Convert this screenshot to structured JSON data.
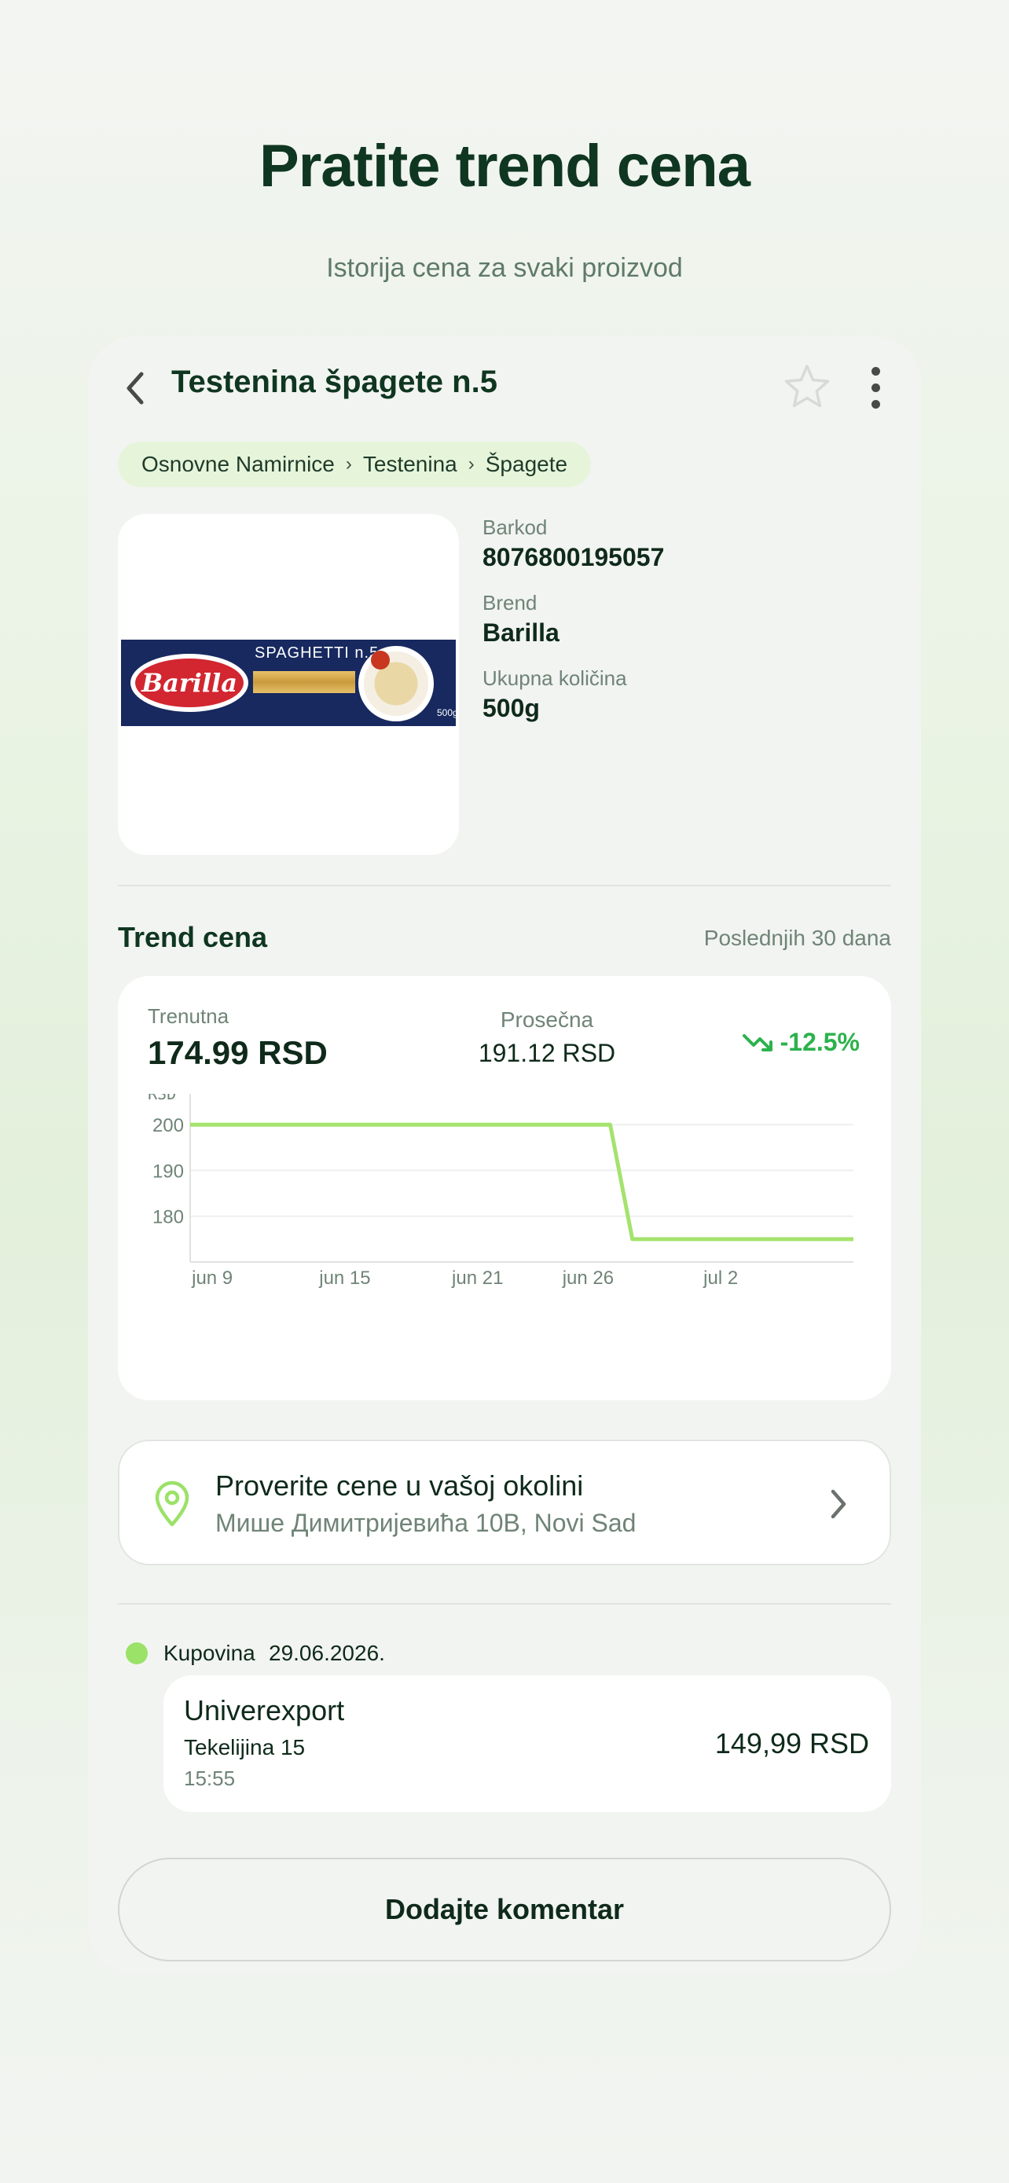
{
  "hero": {
    "title": "Pratite trend cena",
    "subtitle": "Istorija cena za svaki proizvod"
  },
  "product": {
    "title": "Testenina špagete n.5",
    "breadcrumb": [
      "Osnovne Namirnice",
      "Testenina",
      "Špagete"
    ],
    "breadcrumb_separator": "›",
    "image": {
      "brand_text": "Barilla",
      "label_text": "SPAGHETTI n.5",
      "size_text": "500g",
      "box_color": "#17295f",
      "logo_color": "#d22630"
    },
    "fields": {
      "barcode_label": "Barkod",
      "barcode_value": "8076800195057",
      "brand_label": "Brend",
      "brand_value": "Barilla",
      "qty_label": "Ukupna količina",
      "qty_value": "500g"
    }
  },
  "trend": {
    "title": "Trend cena",
    "range": "Poslednjih 30 dana",
    "current_label": "Trenutna",
    "current_value": "174.99 RSD",
    "average_label": "Prosečna",
    "average_value": "191.12 RSD",
    "change": "-12.5%",
    "change_color": "#2bb24c"
  },
  "chart_data": {
    "type": "line",
    "ylabel": "RSD",
    "xlabel": "",
    "x_ticks": [
      "jun 9",
      "jun 15",
      "jun 21",
      "jun 26",
      "jul 2"
    ],
    "y_ticks": [
      180,
      190,
      200
    ],
    "ylim": [
      170,
      205
    ],
    "grid": true,
    "line_color": "#a4e36e",
    "series": [
      {
        "points": [
          {
            "x": "2026-06-08",
            "y": 199.99
          },
          {
            "x": "2026-06-27",
            "y": 199.99
          },
          {
            "x": "2026-06-28",
            "y": 174.99
          },
          {
            "x": "2026-07-08",
            "y": 174.99
          }
        ]
      }
    ]
  },
  "nearby": {
    "title": "Proverite cene u vašoj okolini",
    "address": "Мише Димитријевића 10В, Novi Sad",
    "icon": "map-pin-icon"
  },
  "history": {
    "type_label": "Kupovina",
    "date": "29.06.2026.",
    "dot_color": "#9be268",
    "store": "Univerexport",
    "address": "Tekelijina 15",
    "time": "15:55",
    "price": "149,99 RSD"
  },
  "comment_button": "Dodajte komentar"
}
